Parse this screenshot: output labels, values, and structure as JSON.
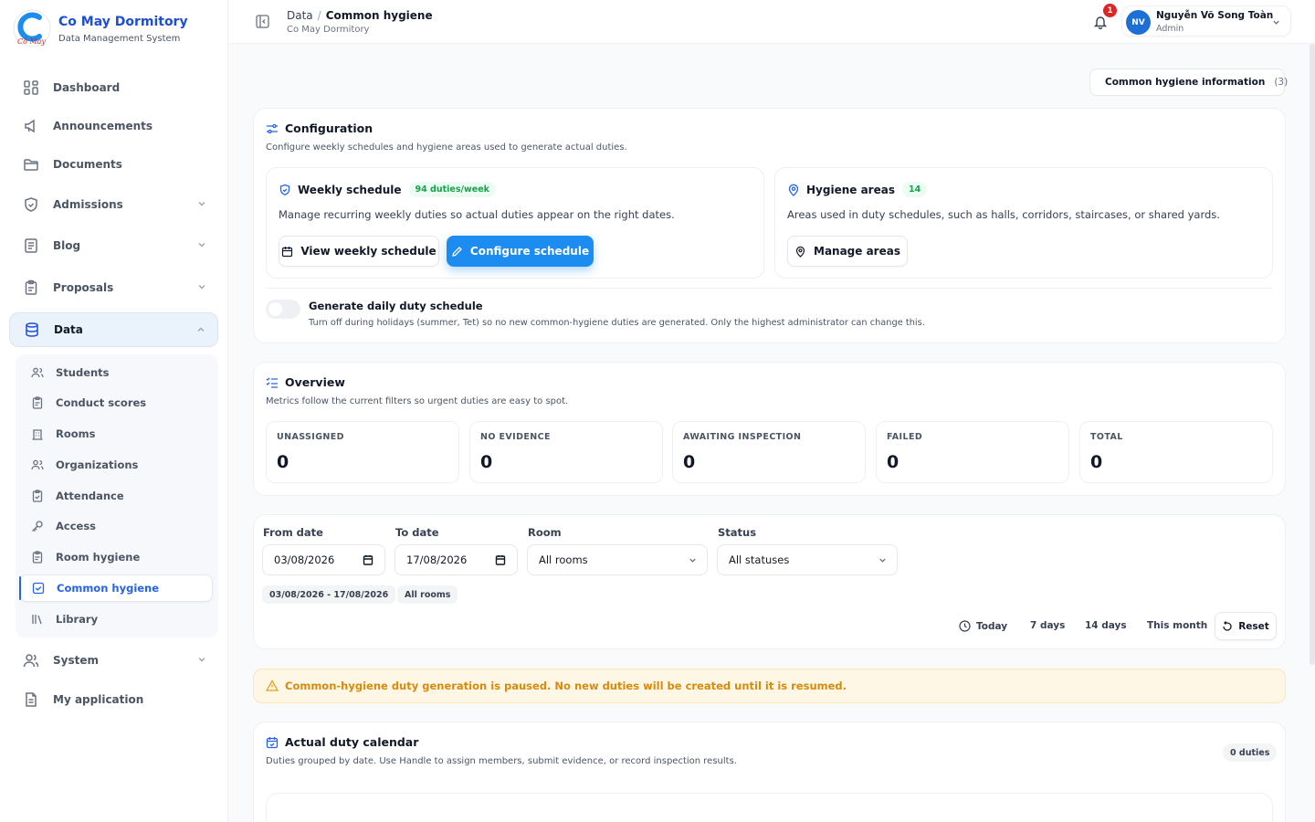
{
  "brand": {
    "title": "Co May Dormitory",
    "subtitle": "Data Management System",
    "logo_text": "Cô May"
  },
  "sidebar": {
    "items": [
      {
        "label": "Dashboard",
        "icon": "grid-icon"
      },
      {
        "label": "Announcements",
        "icon": "megaphone-icon"
      },
      {
        "label": "Documents",
        "icon": "folder-icon"
      },
      {
        "label": "Admissions",
        "icon": "shield-icon"
      },
      {
        "label": "Blog",
        "icon": "newspaper-icon"
      },
      {
        "label": "Proposals",
        "icon": "clipboard-icon"
      },
      {
        "label": "Data",
        "icon": "database-icon"
      },
      {
        "label": "System",
        "icon": "users-icon"
      },
      {
        "label": "My application",
        "icon": "file-icon"
      }
    ],
    "data_sub": [
      {
        "label": "Students",
        "icon": "users-icon"
      },
      {
        "label": "Conduct scores",
        "icon": "clipboard-icon"
      },
      {
        "label": "Rooms",
        "icon": "building-icon"
      },
      {
        "label": "Organizations",
        "icon": "users-icon"
      },
      {
        "label": "Attendance",
        "icon": "clipboard-check-icon"
      },
      {
        "label": "Access",
        "icon": "key-icon"
      },
      {
        "label": "Room hygiene",
        "icon": "clipboard-icon"
      },
      {
        "label": "Common hygiene",
        "icon": "check-square-icon"
      },
      {
        "label": "Library",
        "icon": "library-icon"
      }
    ]
  },
  "header": {
    "breadcrumb_parent": "Data",
    "breadcrumb_sep": "/",
    "breadcrumb_current": "Common hygiene",
    "subtitle": "Co May Dormitory",
    "notification_count": "1",
    "user": {
      "initials": "NV",
      "name": "Nguyễn Võ Song Toàn",
      "role": "Admin"
    }
  },
  "info_button": {
    "label": "Common hygiene information",
    "count": "(3)"
  },
  "configuration": {
    "title": "Configuration",
    "description": "Configure weekly schedules and hygiene areas used to generate actual duties.",
    "weekly": {
      "title": "Weekly schedule",
      "pill": "94 duties/week",
      "description": "Manage recurring weekly duties so actual duties appear on the right dates.",
      "view_label": "View weekly schedule",
      "configure_label": "Configure schedule"
    },
    "areas": {
      "title": "Hygiene areas",
      "pill": "14",
      "description": "Areas used in duty schedules, such as halls, corridors, staircases, or shared yards.",
      "manage_label": "Manage areas"
    },
    "generate": {
      "title": "Generate daily duty schedule",
      "description": "Turn off during holidays (summer, Tet) so no new common-hygiene duties are generated. Only the highest administrator can change this.",
      "enabled": false
    }
  },
  "overview": {
    "title": "Overview",
    "description": "Metrics follow the current filters so urgent duties are easy to spot.",
    "metrics": [
      {
        "label": "UNASSIGNED",
        "value": "0"
      },
      {
        "label": "NO EVIDENCE",
        "value": "0"
      },
      {
        "label": "AWAITING INSPECTION",
        "value": "0"
      },
      {
        "label": "FAILED",
        "value": "0"
      },
      {
        "label": "TOTAL",
        "value": "0"
      }
    ]
  },
  "filters": {
    "from_label": "From date",
    "from_value": "03/08/2026",
    "to_label": "To date",
    "to_value": "17/08/2026",
    "room_label": "Room",
    "room_value": "All rooms",
    "status_label": "Status",
    "status_value": "All statuses",
    "chips": [
      "03/08/2026 - 17/08/2026",
      "All rooms"
    ],
    "quick": [
      "Today",
      "7 days",
      "14 days",
      "This month"
    ],
    "reset_label": "Reset"
  },
  "alert": {
    "text": "Common-hygiene duty generation is paused. No new duties will be created until it is resumed."
  },
  "calendar": {
    "title": "Actual duty calendar",
    "description": "Duties grouped by date. Use Handle to assign members, submit evidence, or record inspection results.",
    "count": "0 duties"
  },
  "colors": {
    "accent": "#1d8cf0",
    "brand": "#1d4ed8",
    "warning": "#d98a0b",
    "success": "#16a34a",
    "danger": "#dc2626"
  }
}
